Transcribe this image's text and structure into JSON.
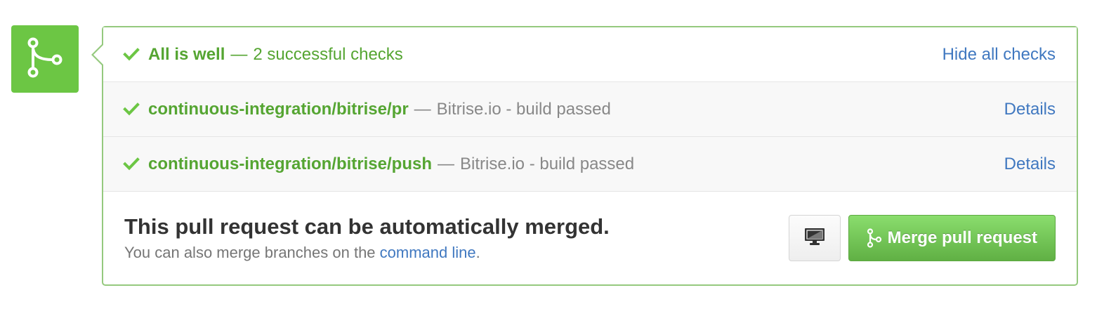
{
  "status": {
    "title": "All is well",
    "separator": "—",
    "subtitle": "2 successful checks",
    "toggle_link": "Hide all checks"
  },
  "checks": [
    {
      "context": "continuous-integration/bitrise/pr",
      "separator": "—",
      "description": "Bitrise.io - build passed",
      "details_link": "Details"
    },
    {
      "context": "continuous-integration/bitrise/push",
      "separator": "—",
      "description": "Bitrise.io - build passed",
      "details_link": "Details"
    }
  ],
  "merge": {
    "title": "This pull request can be automatically merged.",
    "subtitle_prefix": "You can also merge branches on the",
    "subtitle_link": "command line",
    "subtitle_suffix": ".",
    "button_label": "Merge pull request"
  },
  "icons": {
    "badge": "git-merge-icon",
    "check": "checkmark-icon",
    "monitor": "desktop-icon",
    "button": "git-merge-icon"
  },
  "colors": {
    "success_green": "#6cc644",
    "success_text": "#55a532",
    "link_blue": "#4078c0",
    "panel_border": "#95c97e"
  }
}
